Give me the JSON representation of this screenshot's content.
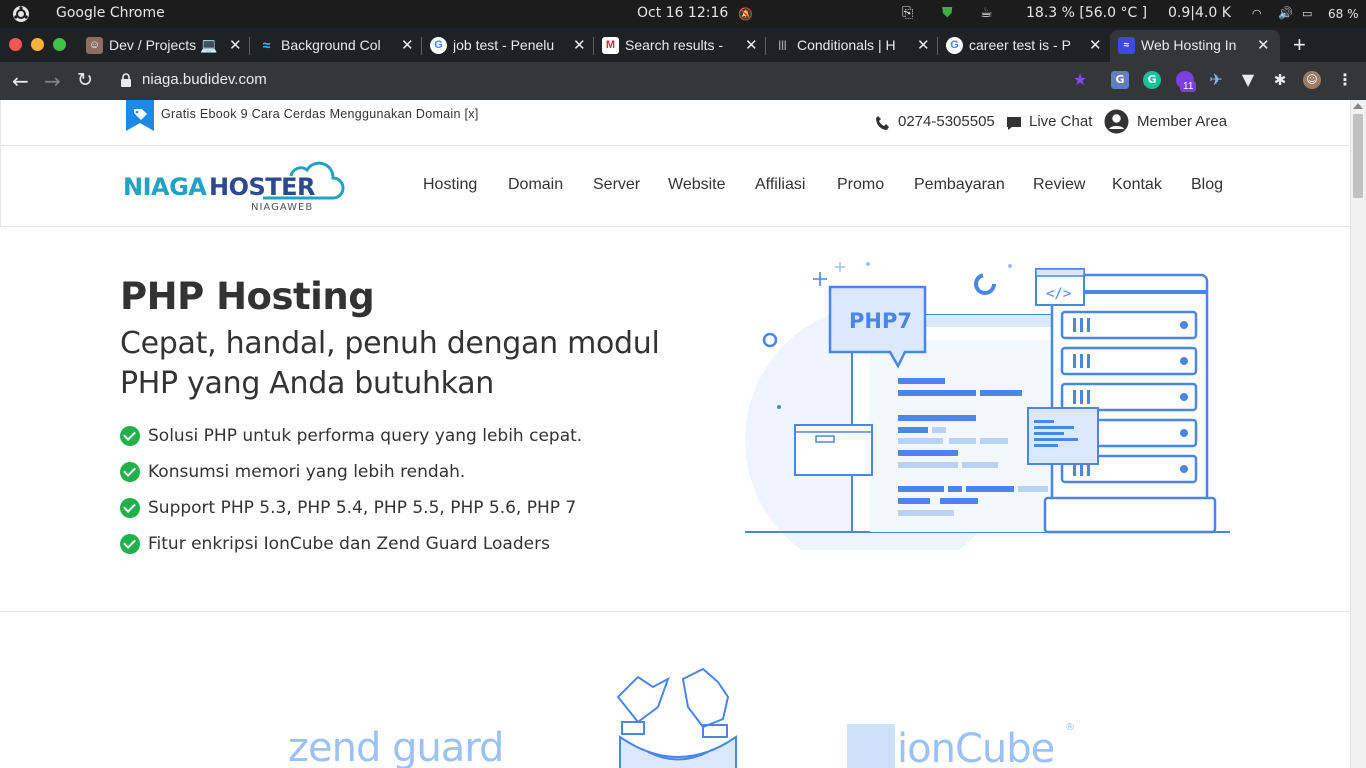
{
  "os": {
    "app_name": "Google Chrome",
    "datetime": "Oct 16  12:16",
    "cpu": "18.3 % [56.0 °C ]",
    "load": "0.9|4.0 K",
    "battery": "68 %"
  },
  "tabs": [
    {
      "label": "Dev / Projects 💻",
      "icon": "avatar-icon"
    },
    {
      "label": "Background Col",
      "icon": "tailwind-icon"
    },
    {
      "label": "job test - Penelu",
      "icon": "google-icon"
    },
    {
      "label": "Search results -",
      "icon": "gmail-icon"
    },
    {
      "label": "Conditionals | H",
      "icon": "doc-icon"
    },
    {
      "label": "career test is - P",
      "icon": "google-icon"
    },
    {
      "label": "Web Hosting In",
      "icon": "niagahoster-icon"
    }
  ],
  "address": {
    "url": "niaga.budidev.com"
  },
  "extensions": {
    "badge": "11"
  },
  "site": {
    "promo": "Gratis Ebook 9 Cara Cerdas Menggunakan Domain [x]",
    "phone": "0274-5305505",
    "live_chat": "Live Chat",
    "member_area": "Member Area",
    "logo_main_a": "NIAGA",
    "logo_main_b": "HOSTER",
    "logo_sub": "NIAGAWEB",
    "nav": [
      "Hosting",
      "Domain",
      "Server",
      "Website",
      "Affiliasi",
      "Promo",
      "Pembayaran",
      "Review",
      "Kontak",
      "Blog"
    ],
    "hero": {
      "title": "PHP Hosting",
      "subtitle": "Cepat, handal, penuh dengan modul PHP yang Anda butuhkan",
      "features": [
        "Solusi PHP untuk performa query yang lebih cepat.",
        "Konsumsi memori yang lebih rendah.",
        "Support PHP 5.3, PHP 5.4, PHP 5.5, PHP 5.6, PHP 7",
        "Fitur enkripsi IonCube dan Zend Guard Loaders"
      ],
      "illustration_label": "PHP7"
    },
    "partners": [
      "zend guard",
      "ionCube"
    ]
  },
  "colors": {
    "brand_blue": "#1e88e5",
    "brand_teal": "#1fa2c4",
    "check_green": "#21b14a",
    "illus_blue": "#4a86e8"
  }
}
